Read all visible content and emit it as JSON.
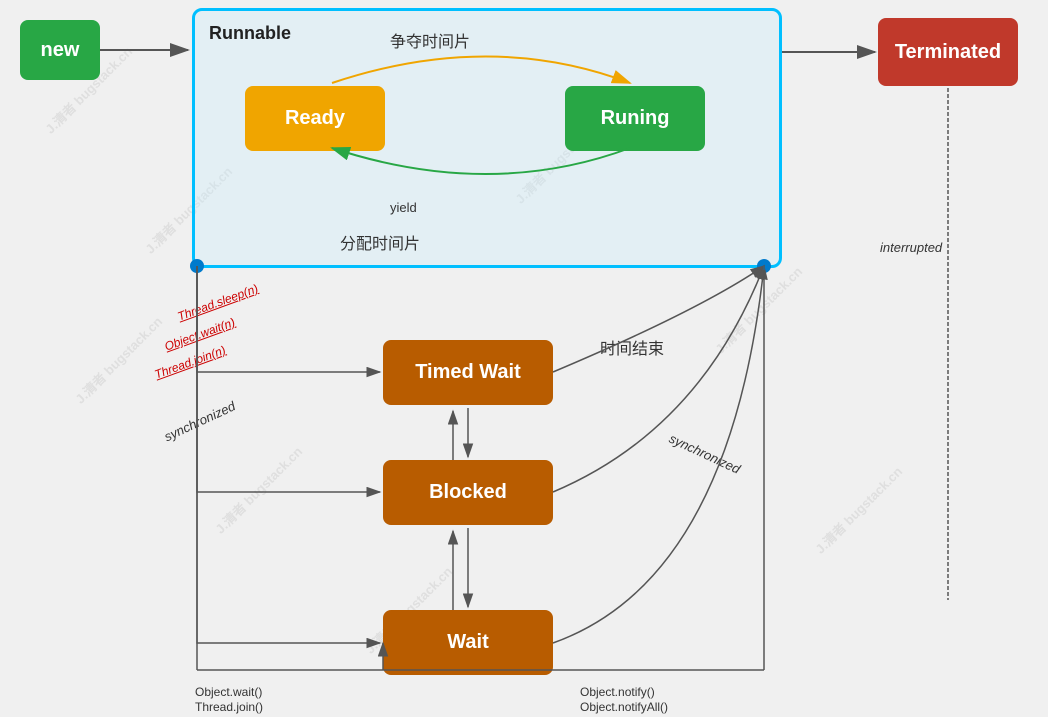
{
  "nodes": {
    "new": "new",
    "terminated": "Terminated",
    "runnable": "Runnable",
    "ready": "Ready",
    "running": "Runing",
    "timedWait": "Timed Wait",
    "blocked": "Blocked",
    "wait": "Wait"
  },
  "labels": {
    "争夺时间片": "争夺时间片",
    "分配时间片": "分配时间片",
    "yield": "yield",
    "interrupted": "interrupted",
    "时间结束": "时间结束",
    "synchronized_right": "synchronized",
    "synchronized_left": "synchronized",
    "threadSleep": "Thread.sleep(n)",
    "objectWaitN": "Object.wait(n)",
    "threadJoinN": "Thread.join(n)",
    "objectWait": "Object.wait()",
    "threadJoin": "Thread.join()",
    "objectNotify": "Object.notify()",
    "objectNotifyAll": "Object.notifyAll()"
  },
  "colors": {
    "new": "#28a745",
    "terminated": "#c0392b",
    "runnable_border": "#00bfff",
    "ready": "#f0a500",
    "running": "#28a745",
    "blocked_states": "#b85c00",
    "dot": "#007acc"
  }
}
